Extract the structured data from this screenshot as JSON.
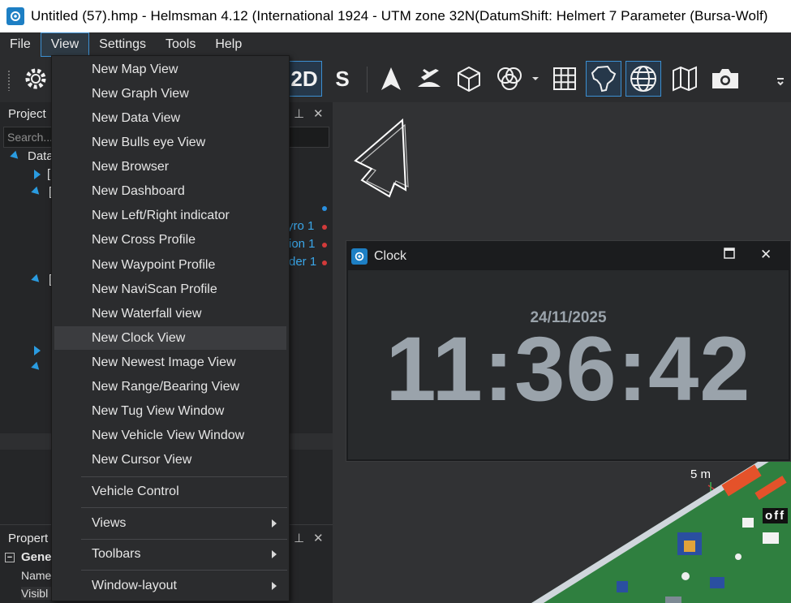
{
  "window": {
    "title": "Untitled (57).hmp - Helmsman 4.12 (International 1924 - UTM zone 32N(DatumShift: Helmert 7 Parameter (Bursa-Wolf)"
  },
  "menubar": {
    "items": [
      "File",
      "View",
      "Settings",
      "Tools",
      "Help"
    ]
  },
  "toolbar": {
    "mode_2d": "2D",
    "mode_s": "S"
  },
  "project_pane": {
    "title": "Project",
    "search_placeholder": "Search...",
    "tree_root": "Data",
    "bracket": "[",
    "sensors": [
      {
        "label": "yro 1",
        "status_color": "#d23a3a"
      },
      {
        "label": "ion 1",
        "status_color": "#d23a3a"
      },
      {
        "label": "der 1",
        "status_color": "#d23a3a"
      }
    ],
    "blue_dot_color": "#2a8fe0"
  },
  "properties_pane": {
    "title": "Propert",
    "group": "Gene",
    "rows": [
      "Name",
      "Visibl"
    ]
  },
  "view_menu": {
    "items": [
      "New Map View",
      "New Graph View",
      "New Data View",
      "New Bulls eye View",
      "New Browser",
      "New Dashboard",
      "New Left/Right indicator",
      "New Cross Profile",
      "New Waypoint Profile",
      "New NaviScan Profile",
      "New Waterfall view",
      "New Clock View",
      "New Newest Image View",
      "New Range/Bearing View",
      "New Tug View Window",
      "New Vehicle View Window",
      "New Cursor View"
    ],
    "highlighted": "New Clock View",
    "vehicle_control": "Vehicle Control",
    "submenus": [
      "Views",
      "Toolbars",
      "Window-layout"
    ]
  },
  "clock_window": {
    "title": "Clock",
    "date": "24/11/2025",
    "time": "11:36:42"
  },
  "map": {
    "scale_label": "5 m",
    "vessel_label": "off"
  },
  "colors": {
    "accent": "#3c8fd1",
    "clock_text": "#9aa3ab",
    "vessel_hull": "#2f7f3f",
    "vessel_orange": "#e4522a"
  }
}
